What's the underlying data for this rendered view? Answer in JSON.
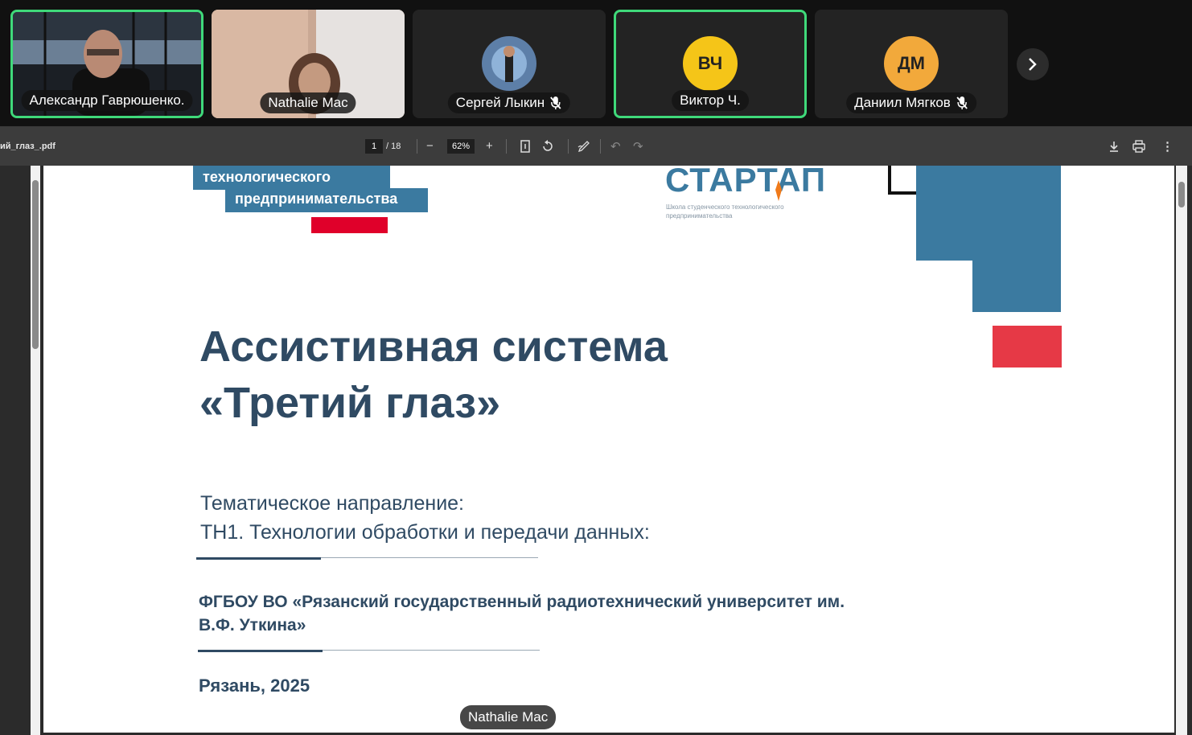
{
  "participants": [
    {
      "name": "Александр Гаврюшенко.",
      "active": true,
      "video": true,
      "muted": false
    },
    {
      "name": "Nathalie Mac",
      "active": false,
      "video": true,
      "muted": false
    },
    {
      "name": "Сергей Лыкин",
      "active": false,
      "video": false,
      "muted": true
    },
    {
      "name": "Виктор Ч.",
      "initials": "ВЧ",
      "active": true,
      "video": false,
      "muted": false,
      "avatar_color": "#f5c518"
    },
    {
      "name": "Даниил Мягков",
      "initials": "ДМ",
      "active": false,
      "video": false,
      "muted": true,
      "avatar_color": "#f2a93b"
    }
  ],
  "pdf": {
    "filename": "ий_глаз_.pdf",
    "page_current": "1",
    "page_total": "/ 18",
    "zoom": "62%"
  },
  "slide": {
    "logo_left_line1": "технологического",
    "logo_left_line2": "предпринимательства",
    "logo_right_title": "СТАРТАП",
    "logo_right_sub1": "Школа студенческого технологического",
    "logo_right_sub2": "предпринимательства",
    "title_line1": "Ассистивная система",
    "title_line2": "«Третий глаз»",
    "direction_line1": "Тематическое направление:",
    "direction_line2": "ТН1. Технологии обработки и передачи данных:",
    "org_line1": "ФГБОУ ВО «Рязанский государственный радиотехнический университет им.",
    "org_line2": "В.Ф. Уткина»",
    "city_year": "Рязань, 2025"
  },
  "floating_label": "Nathalie Mac",
  "colors": {
    "accent_green": "#3fd97a",
    "slide_blue": "#3b7aa0",
    "slide_red": "#e0002a",
    "slide_pink": "#e63946",
    "slide_text": "#2f4a63"
  }
}
